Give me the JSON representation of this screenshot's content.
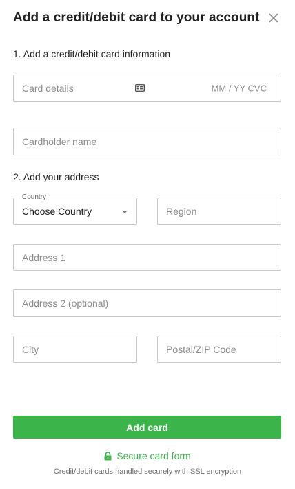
{
  "header": {
    "title": "Add a credit/debit card to your account"
  },
  "section1": {
    "label": "1. Add a credit/debit card information"
  },
  "card": {
    "details_placeholder": "Card details",
    "expiry_cvc_placeholder": "MM / YY  CVC",
    "cardholder_placeholder": "Cardholder name"
  },
  "section2": {
    "label": "2. Add your address"
  },
  "address": {
    "country_legend": "Country",
    "country_value": "Choose Country",
    "region_placeholder": "Region",
    "address1_placeholder": "Address 1",
    "address2_placeholder": "Address 2 (optional)",
    "city_placeholder": "City",
    "postal_placeholder": "Postal/ZIP Code"
  },
  "actions": {
    "add_card_label": "Add card"
  },
  "security": {
    "secure_label": "Secure card form",
    "note": "Credit/debit cards handled securely with SSL encryption"
  },
  "colors": {
    "accent": "#3bb54a",
    "border": "#c9c9c9"
  },
  "icons": [
    "close-icon",
    "card-icon",
    "chevron-down-icon",
    "lock-icon"
  ]
}
